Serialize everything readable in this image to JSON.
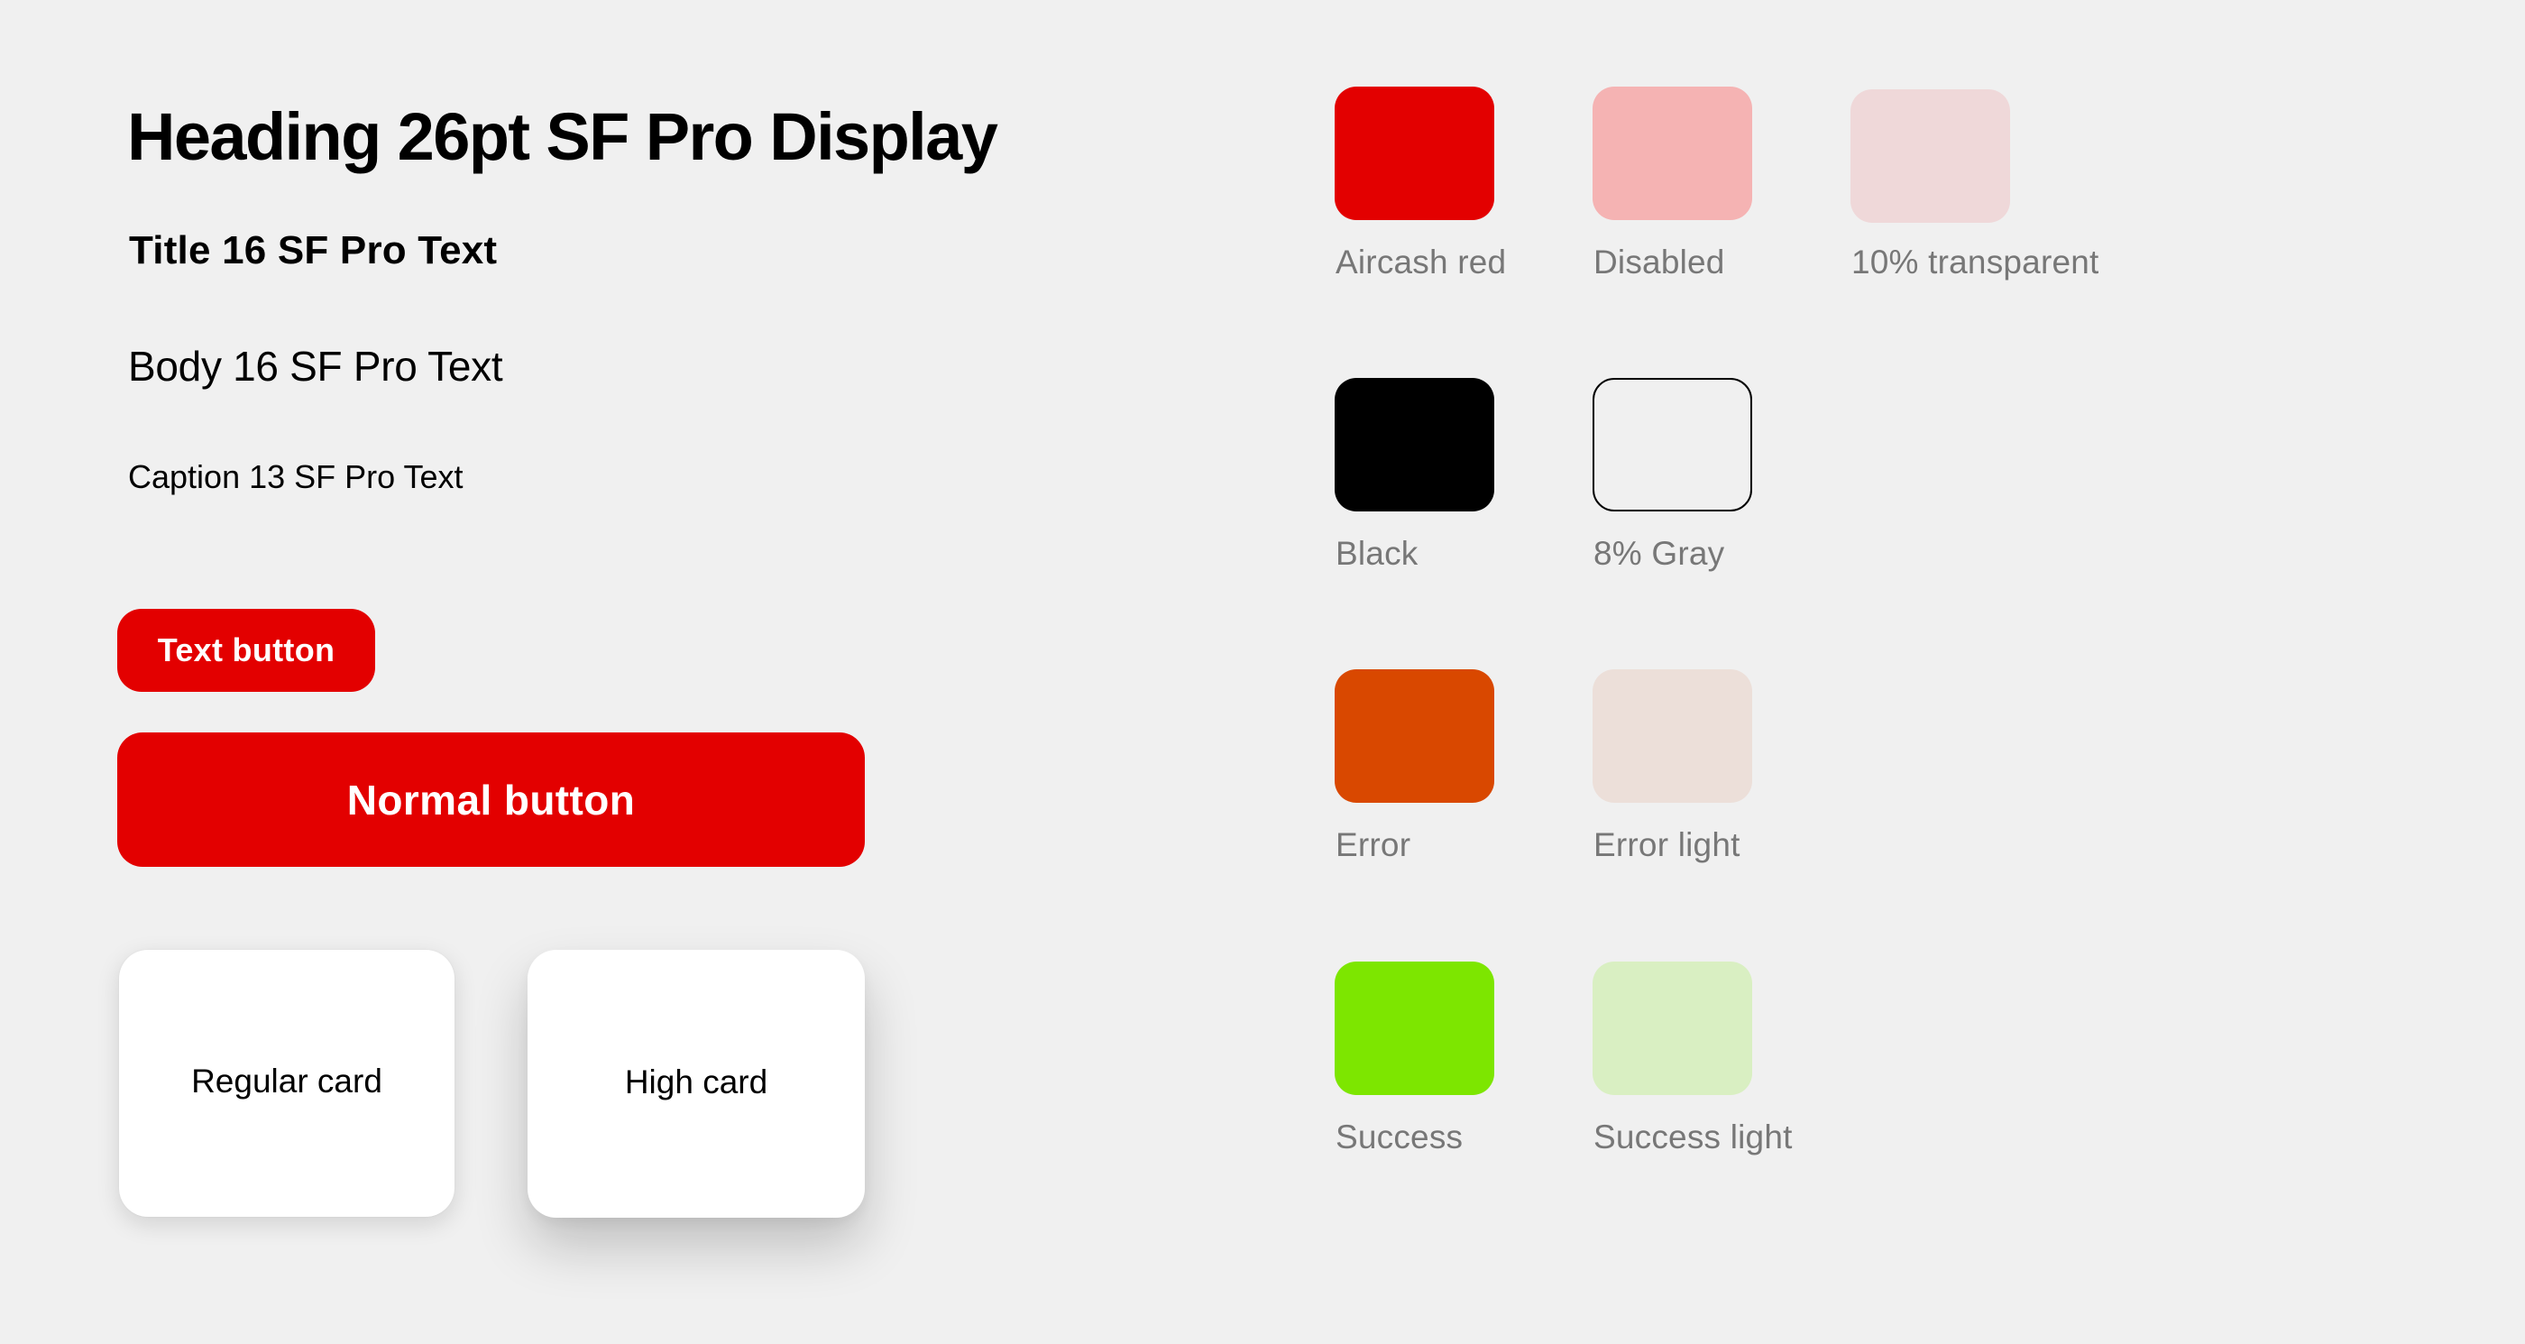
{
  "typography": {
    "heading": "Heading 26pt SF Pro Display",
    "title": "Title 16 SF Pro Text",
    "body": "Body 16 SF Pro Text",
    "caption": "Caption 13 SF Pro Text"
  },
  "buttons": {
    "text_button": "Text button",
    "normal_button": "Normal button",
    "color": "#e30000",
    "label_color": "#ffffff"
  },
  "cards": {
    "regular": "Regular card",
    "high": "High card"
  },
  "palette": [
    {
      "name": "Aircash red",
      "color": "#e30000",
      "row": 0,
      "col": 0
    },
    {
      "name": "Disabled",
      "color": "#f5b3b3",
      "row": 0,
      "col": 1
    },
    {
      "name": "10% transparent",
      "color": "#efd8d9",
      "row": 0,
      "col": 2
    },
    {
      "name": "Black",
      "color": "#000000",
      "row": 1,
      "col": 0
    },
    {
      "name": "8% Gray",
      "color": "#f0f0f0",
      "row": 1,
      "col": 1,
      "outlined": true
    },
    {
      "name": "Error",
      "color": "#d94800",
      "row": 2,
      "col": 0
    },
    {
      "name": "Error light",
      "color": "#ecdfd9",
      "row": 2,
      "col": 1
    },
    {
      "name": "Success",
      "color": "#7de600",
      "row": 3,
      "col": 0
    },
    {
      "name": "Success light",
      "color": "#d9efc2",
      "row": 3,
      "col": 1
    }
  ]
}
